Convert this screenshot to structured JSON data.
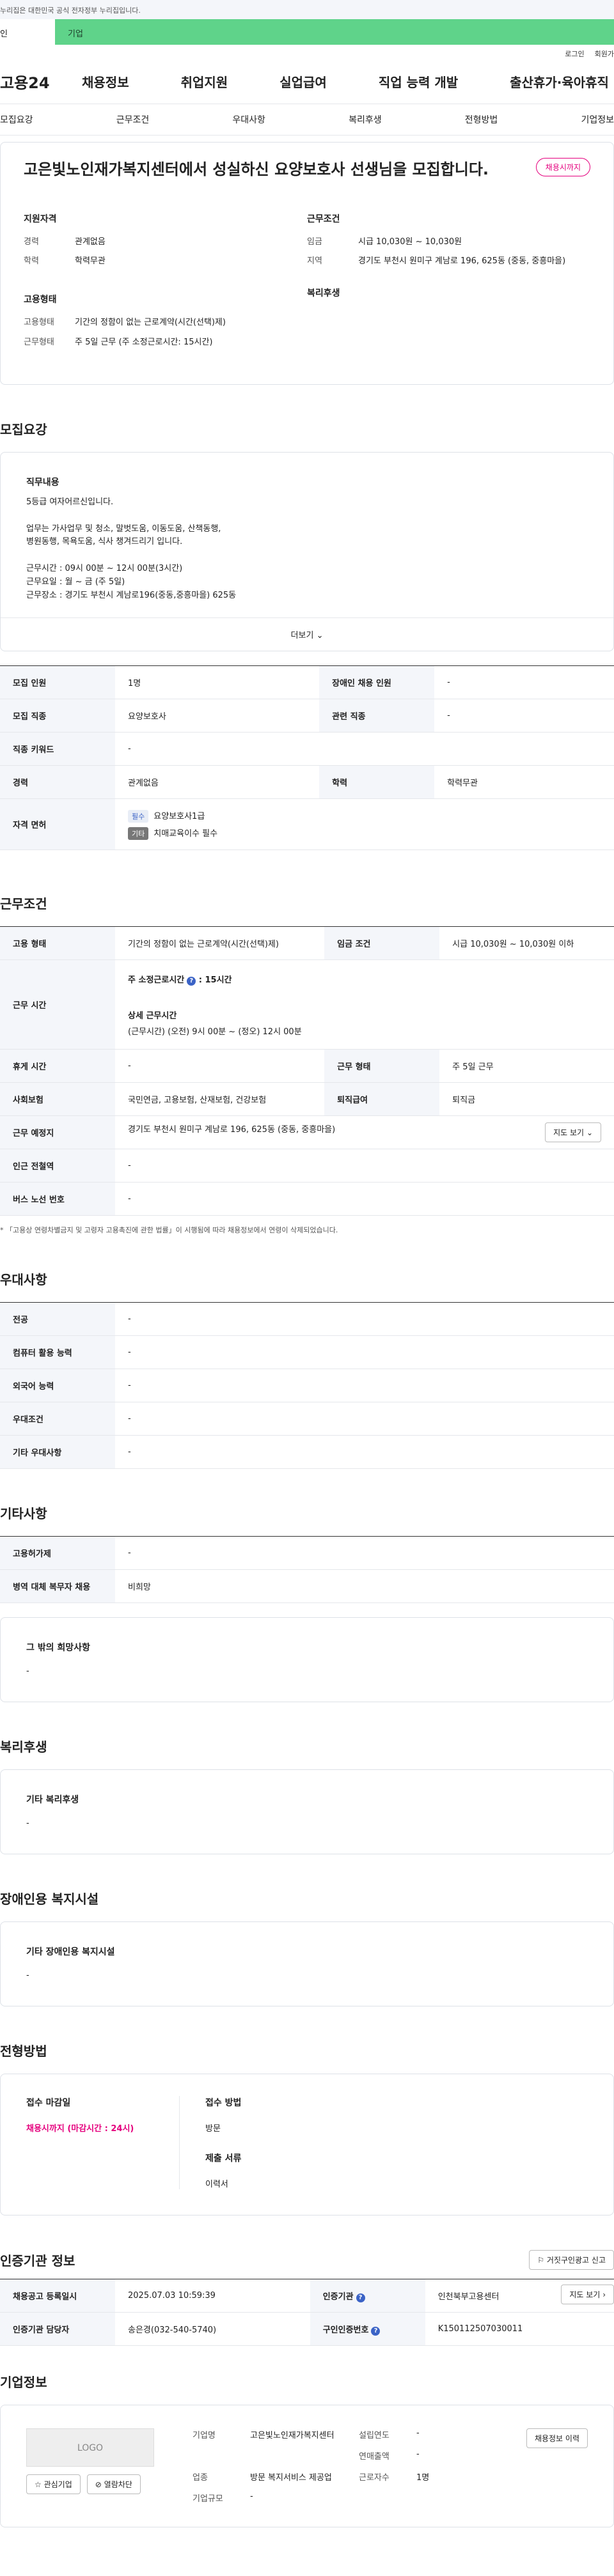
{
  "topbar": {
    "notice": "누리집은 대한민국 공식 전자정부 누리집입니다."
  },
  "header": {
    "tab_personal": "인",
    "tab_corp": "기업",
    "util": [
      "로그인",
      "회원가"
    ],
    "logo": "고용24",
    "gnb": [
      "채용정보",
      "취업지원",
      "실업급여",
      "직업 능력 개발",
      "출산휴가·육아휴직"
    ]
  },
  "snb": [
    "모집요강",
    "근무조건",
    "우대사항",
    "복리후생",
    "전형방법",
    "기업정보"
  ],
  "summary": {
    "title": "고은빛노인재가복지센터에서 성실하신 요양보호사 선생님을 모집합니다.",
    "badge": "채용시까지",
    "col1": {
      "h1": "지원자격",
      "rows": [
        {
          "k": "경력",
          "v": "관계없음"
        },
        {
          "k": "학력",
          "v": "학력무관"
        }
      ],
      "h2": "고용형태",
      "rows2": [
        {
          "k": "고용형태",
          "v": "기간의 정함이 없는 근로계약(시간(선택)제)"
        },
        {
          "k": "근무형태",
          "v": "주 5일 근무 (주 소정근로시간: 15시간)"
        }
      ]
    },
    "col2": {
      "h1": "근무조건",
      "rows": [
        {
          "k": "임금",
          "v": "시급 10,030원 ~ 10,030원"
        },
        {
          "k": "지역",
          "v": "경기도 부천시 원미구 계남로 196, 625동 (중동, 중흥마을)"
        }
      ],
      "h2": "복리후생"
    }
  },
  "recruit": {
    "title": "모집요강",
    "duty_title": "직무내용",
    "duty_text": "5등급  여자어르신입니다.\n\n업무는 가사업무 및 청소, 말벗도움, 이동도움, 산책동행,\n병원동행, 목욕도움, 식사 챙겨드리기  입니다.\n\n근무시간 : 09시 00분 ~ 12시 00분(3시간)\n근무요일 : 월 ~ 금 (주 5일)\n근무장소 : 경기도 부천시 계남로196(중동,중흥마을) 625동",
    "more": "더보기",
    "table": [
      {
        "k1": "모집 인원",
        "v1": "1명",
        "k2": "장애인 채용 인원",
        "v2": "-"
      },
      {
        "k1": "모집 직종",
        "v1": "요양보호사",
        "k2": "관련 직종",
        "v2": "-"
      },
      {
        "k1": "직종 키워드",
        "v1": "-"
      },
      {
        "k1": "경력",
        "v1": "관계없음",
        "k2": "학력",
        "v2": "학력무관"
      }
    ],
    "license_label": "자격 면허",
    "license": [
      {
        "tag": "필수",
        "v": "요양보호사1급"
      },
      {
        "tag": "기타",
        "v": "치매교육이수 필수"
      }
    ]
  },
  "work": {
    "title": "근무조건",
    "emp_type_k": "고용 형태",
    "emp_type_v": "기간의 정함이 없는 근로계약(시간(선택)제)",
    "wage_k": "임금 조건",
    "wage_v": "시급 10,030원 ~ 10,030원 이하",
    "hours_k": "근무 시간",
    "hours_weekly_label": "주 소정근로시간",
    "hours_weekly_value": ": 15시간",
    "hours_detail_label": "상세 근무시간",
    "hours_detail_value": "(근무시간) (오전) 9시 00분 ~ (정오) 12시 00분",
    "rest_k": "휴게 시간",
    "rest_v": "-",
    "form_k": "근무 형태",
    "form_v": "주 5일 근무",
    "ins_k": "사회보험",
    "ins_v": "국민연금, 고용보험, 산재보험, 건강보험",
    "ret_k": "퇴직급여",
    "ret_v": "퇴직금",
    "place_k": "근무 예정지",
    "place_v": "경기도 부천시 원미구 계남로 196, 625동 (중동, 중흥마을)",
    "map_btn": "지도 보기",
    "sub_k": "인근 전철역",
    "sub_v": "-",
    "bus_k": "버스 노선 번호",
    "bus_v": "-",
    "note": "* 「고용상 연령차별금지 및 고령자 고용촉진에 관한 법률」이 시행됨에 따라 채용정보에서 연령이 삭제되었습니다."
  },
  "pref": {
    "title": "우대사항",
    "rows": [
      {
        "k": "전공",
        "v": "-"
      },
      {
        "k": "컴퓨터 활용 능력",
        "v": "-"
      },
      {
        "k": "외국어 능력",
        "v": "-"
      },
      {
        "k": "우대조건",
        "v": "-"
      },
      {
        "k": "기타 우대사항",
        "v": "-"
      }
    ]
  },
  "etc": {
    "title": "기타사항",
    "rows": [
      {
        "k": "고용허가제",
        "v": "-"
      },
      {
        "k": "병역 대체 복무자 채용",
        "v": "비희망"
      }
    ],
    "box_title": "그 밖의 희망사항",
    "box_value": "-"
  },
  "welfare": {
    "title": "복리후생",
    "box_title": "기타 복리후생",
    "box_value": "-"
  },
  "disability": {
    "title": "장애인용 복지시설",
    "box_title": "기타 장애인용 복지시설",
    "box_value": "-"
  },
  "selection": {
    "title": "전형방법",
    "deadline_label": "접수 마감일",
    "deadline_value": "채용시까지 (마감시간 : 24시)",
    "method_label": "접수 방법",
    "method_value": "방문",
    "docs_label": "제출 서류",
    "docs_value": "이력서"
  },
  "agency": {
    "title": "인증기관 정보",
    "report_btn": "거짓구인광고 신고",
    "reg_k": "채용공고 등록일시",
    "reg_v": "2025.07.03 10:59:39",
    "org_k": "인증기관",
    "org_v": "인천북부고용센터",
    "map_btn": "지도 보기",
    "mgr_k": "인증기관 담당자",
    "mgr_v": "송은경(032-540-5740)",
    "id_k": "구인인증번호",
    "id_v": "K150112507030011"
  },
  "corp": {
    "title": "기업정보",
    "logo_text": "LOGO",
    "fav_btn": "관심기업",
    "block_btn": "열람차단",
    "name_k": "기업명",
    "name_v": "고은빛노인재가복지센터",
    "year_k": "설립연도",
    "year_v": "-",
    "sales_k": "연매출액",
    "sales_v": "-",
    "biz_k": "업종",
    "biz_v": "방문 복지서비스 제공업",
    "emp_k": "근로자수",
    "emp_v": "1명",
    "size_k": "기업규모",
    "size_v": "-",
    "hist_btn": "채용정보 이력"
  }
}
